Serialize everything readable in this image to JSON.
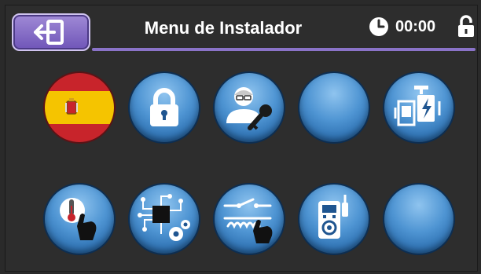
{
  "header": {
    "title": "Menu de Instalador",
    "time": "00:00",
    "back_icon": "exit-arrow-icon",
    "clock_icon": "clock-icon",
    "lock_icon": "unlocked-padlock-icon"
  },
  "colors": {
    "accent": "#8a73c8",
    "button_blue": "#4f95d3",
    "background": "#2d2d2d"
  },
  "grid": {
    "row1": [
      {
        "name": "language-spain",
        "icon": "spain-flag-icon"
      },
      {
        "name": "lock",
        "icon": "padlock-icon"
      },
      {
        "name": "installer-key",
        "icon": "user-key-icon"
      },
      {
        "name": "empty-slot-1",
        "icon": ""
      },
      {
        "name": "power-board",
        "icon": "power-board-icon"
      }
    ],
    "row2": [
      {
        "name": "temperature-touch",
        "icon": "thermometer-touch-icon"
      },
      {
        "name": "circuit-settings",
        "icon": "circuit-gears-icon"
      },
      {
        "name": "switch-coil-touch",
        "icon": "switch-coil-icon"
      },
      {
        "name": "multimeter",
        "icon": "multimeter-icon"
      },
      {
        "name": "empty-slot-2",
        "icon": ""
      }
    ]
  }
}
